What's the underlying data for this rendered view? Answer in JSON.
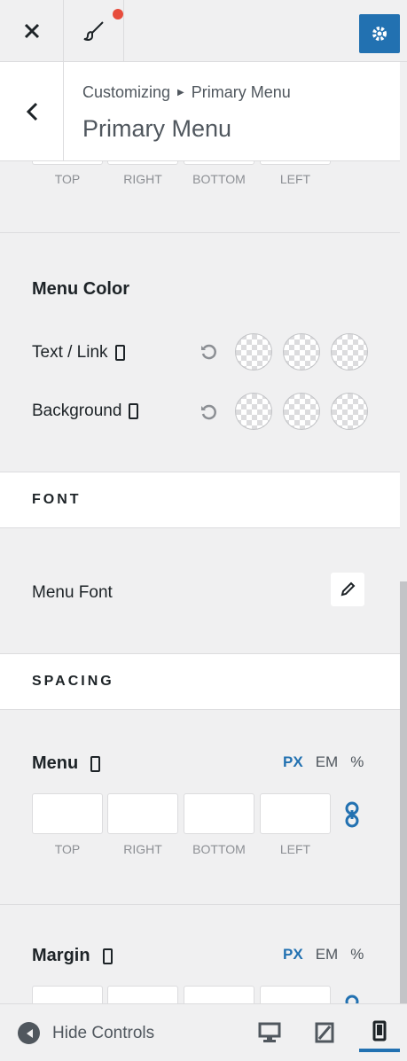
{
  "topbar": {
    "close_icon": "close-icon",
    "brush_icon": "paintbrush-icon",
    "settings_icon": "gear-icon",
    "accent": "#2271b1",
    "notify_color": "#e74c3c"
  },
  "header": {
    "breadcrumb_root": "Customizing",
    "breadcrumb_current": "Primary Menu",
    "title": "Primary Menu"
  },
  "top_padding": {
    "labels": [
      "TOP",
      "RIGHT",
      "BOTTOM",
      "LEFT"
    ]
  },
  "menu_color": {
    "heading": "Menu Color",
    "rows": [
      {
        "label": "Text / Link"
      },
      {
        "label": "Background"
      }
    ]
  },
  "font_band": {
    "label": "FONT"
  },
  "menu_font": {
    "label": "Menu Font"
  },
  "spacing_band": {
    "label": "SPACING"
  },
  "menu_spacing": {
    "heading": "Menu",
    "units": [
      "PX",
      "EM",
      "%"
    ],
    "active_unit": "PX",
    "labels": [
      "TOP",
      "RIGHT",
      "BOTTOM",
      "LEFT"
    ]
  },
  "margin_spacing": {
    "heading": "Margin",
    "units": [
      "PX",
      "EM",
      "%"
    ],
    "active_unit": "PX"
  },
  "footer": {
    "hide_controls": "Hide Controls",
    "devices": [
      "desktop-icon",
      "tablet-icon",
      "mobile-icon"
    ],
    "active_device": "mobile"
  }
}
